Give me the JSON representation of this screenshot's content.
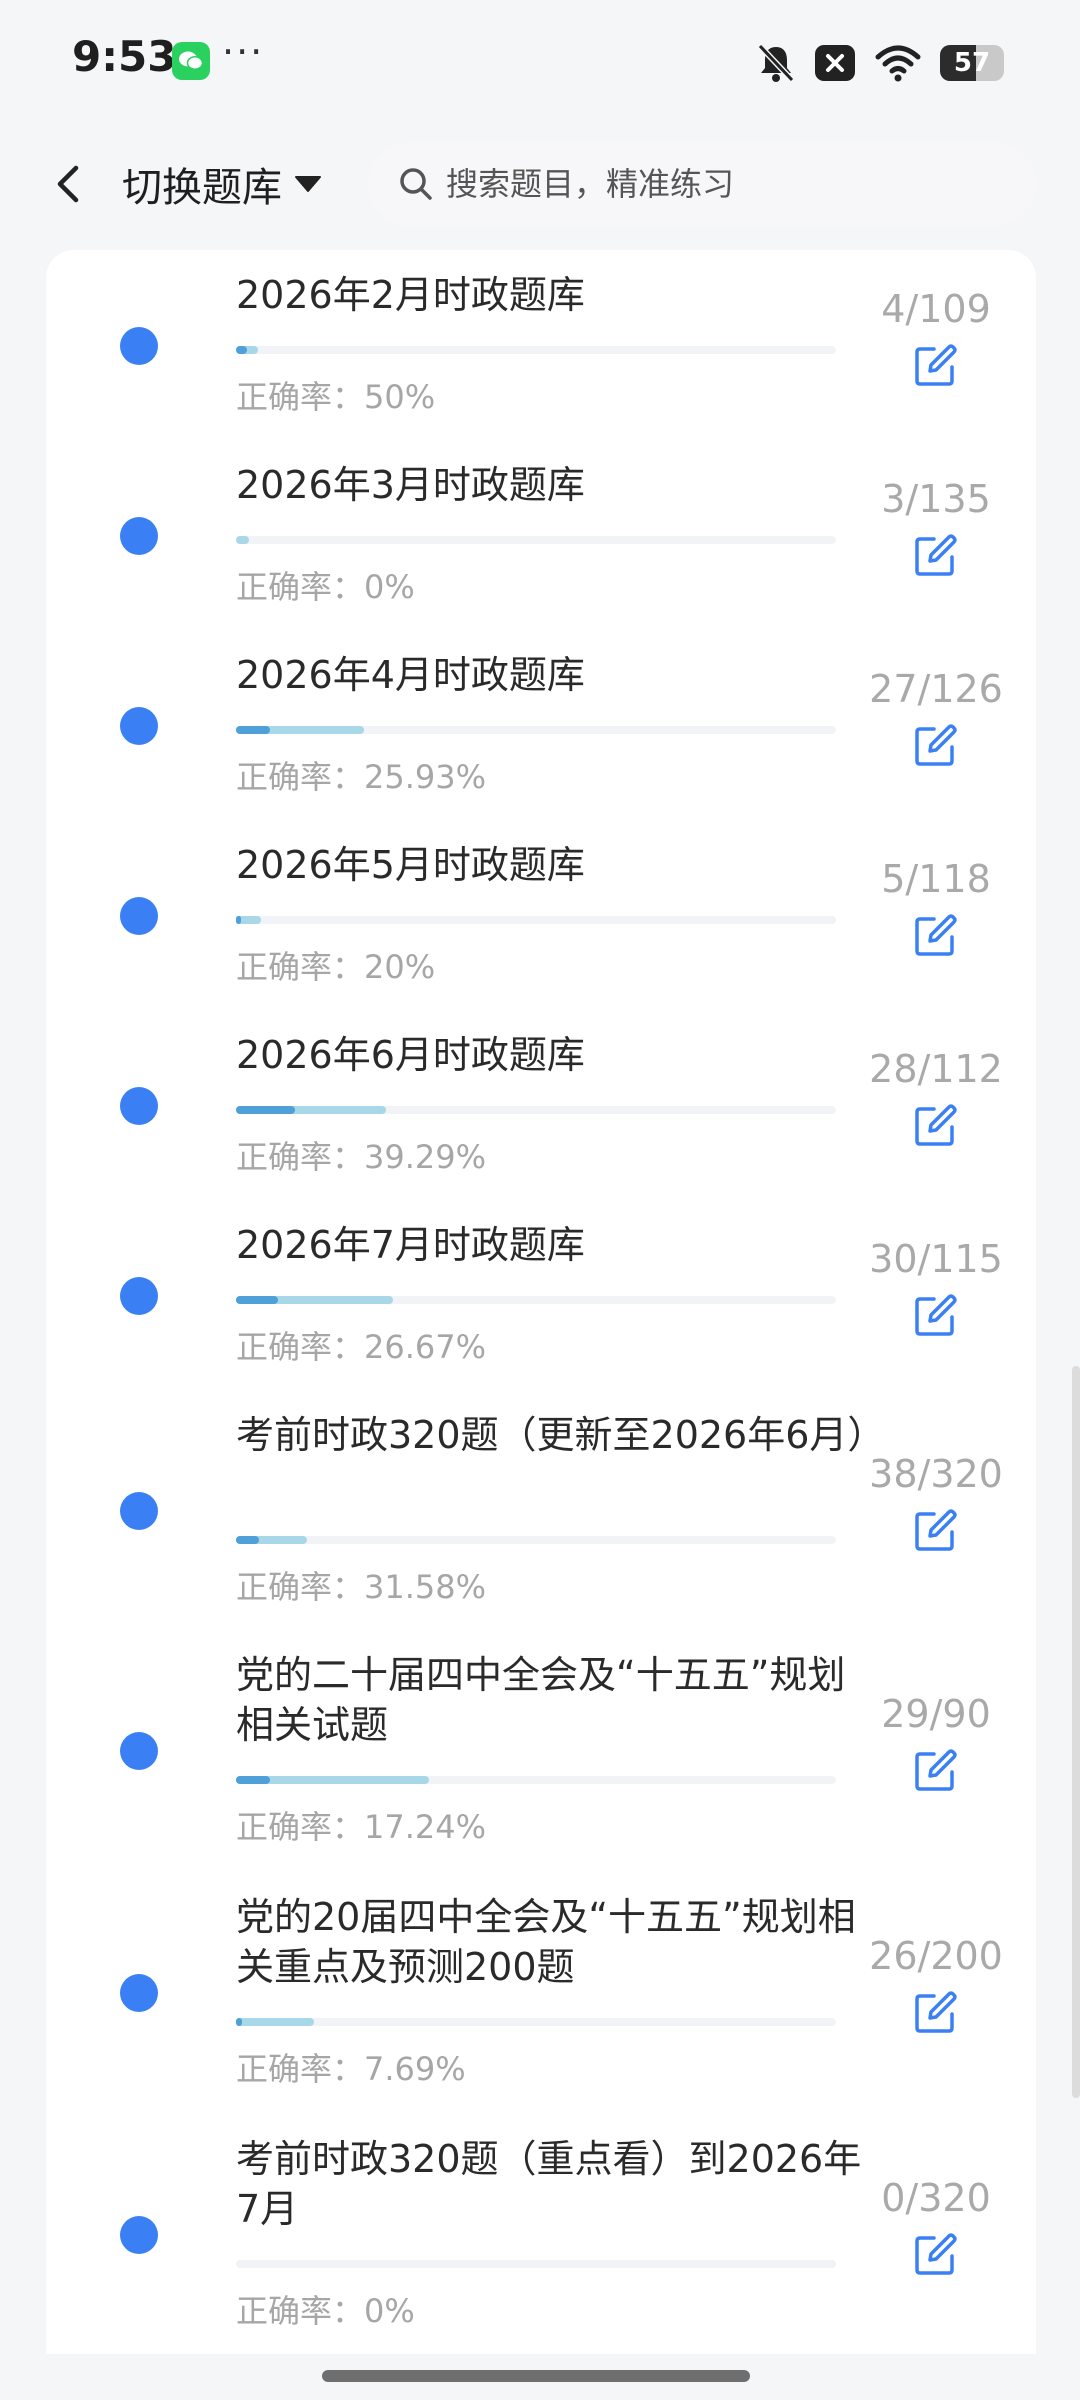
{
  "status_bar": {
    "time": "9:53",
    "more": "···",
    "battery": "57",
    "app_icon": "wechat-icon"
  },
  "header": {
    "switch_label": "切换题库",
    "search_placeholder": "搜索题目，精准练习"
  },
  "colors": {
    "dot": "#3a80f4",
    "progress_done": "#a8d8e8",
    "progress_correct": "#4f9fd8",
    "edit_icon": "#3a80f4"
  },
  "banks": [
    {
      "title": "2026年2月时政题库",
      "accuracy": "正确率：50%",
      "count": "4/109",
      "done_fraction": 0.037,
      "correct_fraction": 0.018
    },
    {
      "title": "2026年3月时政题库",
      "accuracy": "正确率：0%",
      "count": "3/135",
      "done_fraction": 0.022,
      "correct_fraction": 0
    },
    {
      "title": "2026年4月时政题库",
      "accuracy": "正确率：25.93%",
      "count": "27/126",
      "done_fraction": 0.214,
      "correct_fraction": 0.056
    },
    {
      "title": "2026年5月时政题库",
      "accuracy": "正确率：20%",
      "count": "5/118",
      "done_fraction": 0.042,
      "correct_fraction": 0.008
    },
    {
      "title": "2026年6月时政题库",
      "accuracy": "正确率：39.29%",
      "count": "28/112",
      "done_fraction": 0.25,
      "correct_fraction": 0.098
    },
    {
      "title": "2026年7月时政题库",
      "accuracy": "正确率：26.67%",
      "count": "30/115",
      "done_fraction": 0.261,
      "correct_fraction": 0.07
    },
    {
      "title": "考前时政320题（更新至2026年6月）",
      "accuracy": "正确率：31.58%",
      "count": "38/320",
      "done_fraction": 0.119,
      "correct_fraction": 0.038
    },
    {
      "title": "党的二十届四中全会及“十五五”规划相关试题",
      "accuracy": "正确率：17.24%",
      "count": "29/90",
      "done_fraction": 0.322,
      "correct_fraction": 0.056
    },
    {
      "title": "党的20届四中全会及“十五五”规划相关重点及预测200题",
      "accuracy": "正确率：7.69%",
      "count": "26/200",
      "done_fraction": 0.13,
      "correct_fraction": 0.01
    },
    {
      "title": "考前时政320题（重点看）到2026年7月",
      "accuracy": "正确率：0%",
      "count": "0/320",
      "done_fraction": 0,
      "correct_fraction": 0
    }
  ]
}
